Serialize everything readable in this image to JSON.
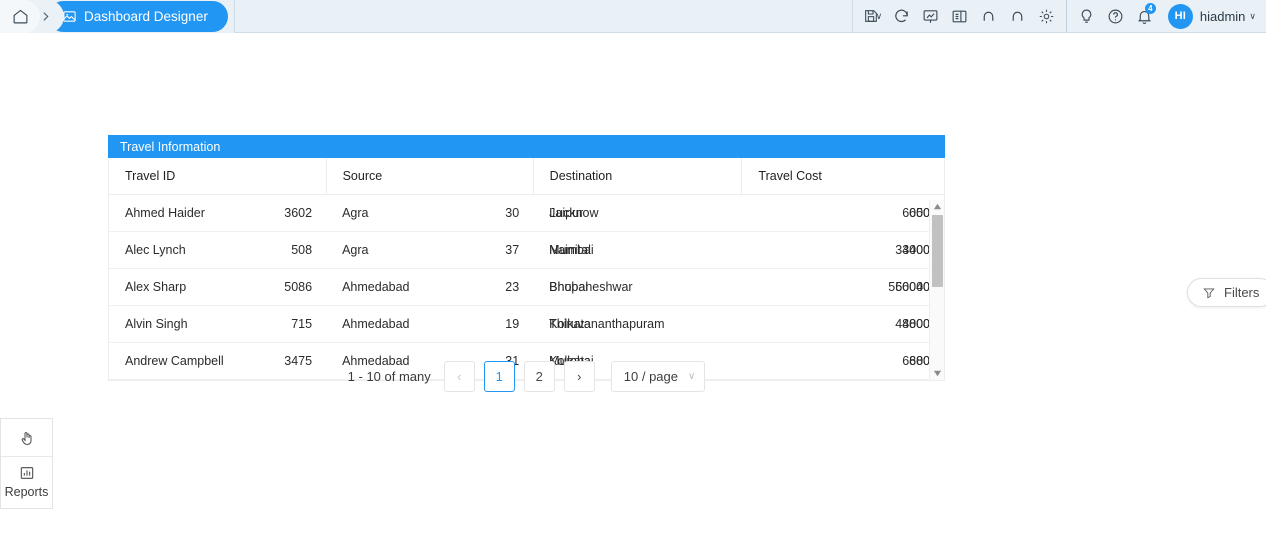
{
  "header": {
    "home_icon": "home-icon",
    "separator_icon": "chevron-right-icon",
    "active_tab": {
      "label": "Dashboard Designer",
      "icon": "image-icon"
    },
    "left_tools": [
      {
        "name": "save-dropdown-button",
        "icon": "save-icon",
        "caret": "∨"
      },
      {
        "name": "refresh-button",
        "icon": "refresh-icon"
      },
      {
        "name": "presentation-button",
        "icon": "presentation-icon"
      },
      {
        "name": "panel-toggle-button",
        "icon": "panel-icon"
      },
      {
        "name": "undo-button",
        "icon": "undo-icon"
      },
      {
        "name": "redo-button",
        "icon": "redo-icon"
      },
      {
        "name": "settings-button",
        "icon": "gear-icon"
      }
    ],
    "right_tools": [
      {
        "name": "ideas-button",
        "icon": "lightbulb-icon"
      },
      {
        "name": "help-button",
        "icon": "question-circle-icon"
      },
      {
        "name": "notifications-button",
        "icon": "bell-icon",
        "badge": "4"
      }
    ],
    "user": {
      "initials": "HI",
      "name": "hiadmin",
      "caret": "∨"
    }
  },
  "dock": {
    "pointer_icon": "hand-pointer-icon",
    "items": [
      {
        "label": "Reports",
        "icon": "bar-chart-icon"
      }
    ]
  },
  "filters_button": {
    "label": "Filters",
    "icon": "funnel-icon"
  },
  "widget": {
    "title": "Travel Information",
    "columns": [
      "Travel ID",
      "Source",
      "Destination",
      "Travel Cost"
    ],
    "rows": [
      {
        "travel_id": "Ahmed Haider",
        "travel_id_num": "3602",
        "source": "Agra",
        "source_num": "30",
        "destination": "Lucknow",
        "destination_alt": "Jaipur",
        "cost": "6000",
        "cost_alt": "650"
      },
      {
        "travel_id": "Alec Lynch",
        "travel_id_num": "508",
        "source": "Agra",
        "source_num": "37",
        "destination": "Mumbai",
        "destination_alt": "Nainital",
        "cost": "34000",
        "cost_alt": "3400"
      },
      {
        "travel_id": "Alex Sharp",
        "travel_id_num": "5086",
        "source": "Ahmedabad",
        "source_num": "23",
        "destination": "Bhubaneshwar",
        "destination_alt": "Bhopal",
        "cost": "56000",
        "cost_alt": "560040"
      },
      {
        "travel_id": "Alvin Singh",
        "travel_id_num": "715",
        "source": "Ahmedabad",
        "source_num": "19",
        "destination": "Thiruvananthapuram",
        "destination_alt": "Kolkata",
        "cost": "48000",
        "cost_alt": "4800"
      },
      {
        "travel_id": "Andrew Campbell",
        "travel_id_num": "3475",
        "source": "Ahmedabad",
        "source_num": "31",
        "destination": "Mumbai",
        "destination_alt": "Kolkata",
        "cost": "6800",
        "cost_alt": "680"
      }
    ],
    "scrollbar": {
      "up_icon": "caret-up-icon",
      "down_icon": "caret-down-icon"
    }
  },
  "pagination": {
    "info": "1 - 10 of many",
    "prev": "‹",
    "next": "›",
    "pages": [
      "1",
      "2"
    ],
    "active_page": "1",
    "page_size": "10 / page",
    "caret": "∨"
  },
  "colors": {
    "accent": "#2196f3",
    "topbar_bg": "#e9f1f7",
    "title_bar": "#2196f3"
  }
}
